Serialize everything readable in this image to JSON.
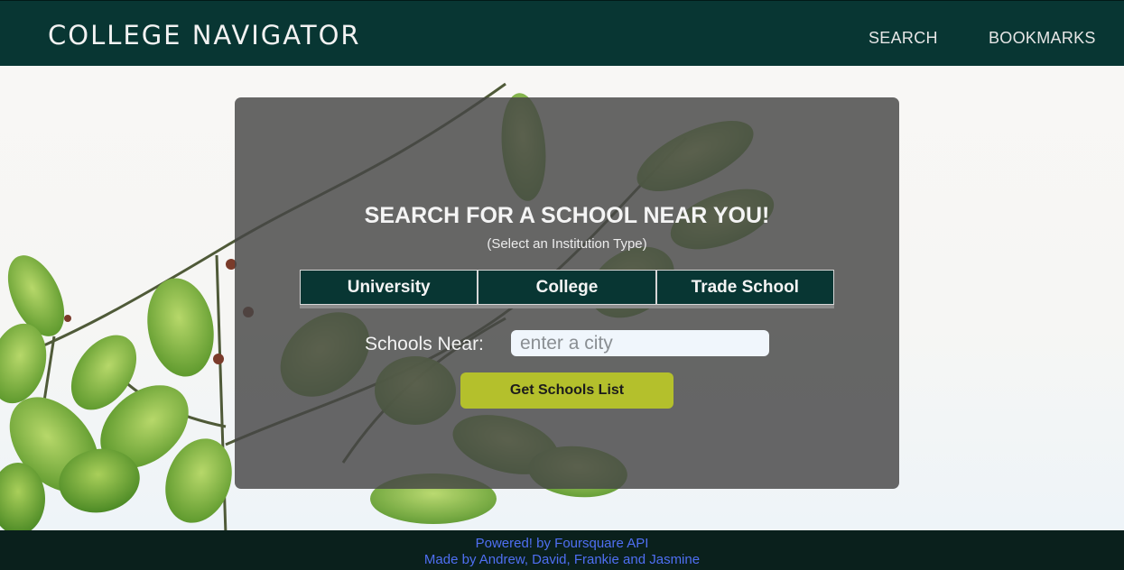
{
  "app": {
    "brand": "COLLEGE NAVIGATOR"
  },
  "nav": {
    "search_label": "SEARCH",
    "bookmarks_label": "BOOKMARKS"
  },
  "search_card": {
    "title": "SEARCH FOR A SCHOOL NEAR YOU!",
    "subtitle": "(Select an Institution Type)",
    "institution_types": [
      "University",
      "College",
      "Trade School"
    ],
    "near_label": "Schools Near:",
    "city_placeholder": "enter a city",
    "city_value": "",
    "submit_label": "Get Schools List"
  },
  "footer": {
    "powered_by": "Powered! by Foursquare API",
    "credits": "Made by Andrew, David, Frankie and Jasmine"
  },
  "colors": {
    "navbar": "#083633",
    "institution_button": "#083633",
    "submit_button": "#b4c02c",
    "footer_bg": "#0a201c",
    "footer_text": "#4f6ff2"
  },
  "icons": {
    "background": "leaf-branch-background"
  }
}
